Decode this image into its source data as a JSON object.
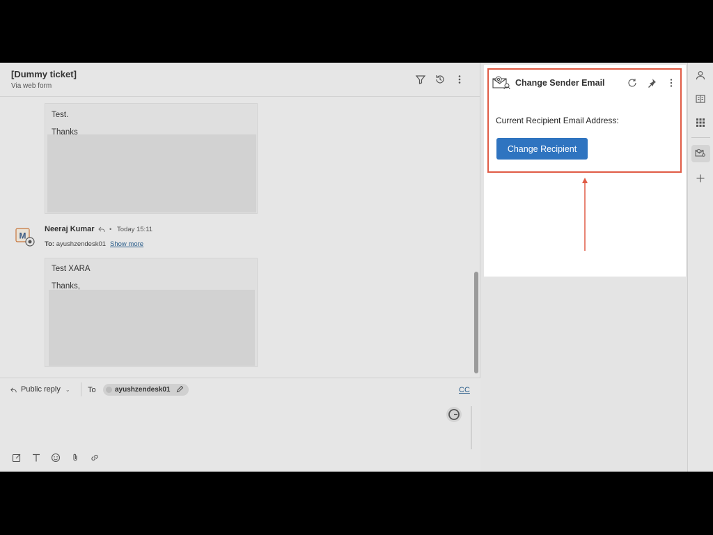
{
  "ticket": {
    "title": "[Dummy ticket]",
    "subtitle": "Via web form"
  },
  "messages": [
    {
      "lines": [
        "Test.",
        "Thanks"
      ]
    },
    {
      "author": "Neeraj Kumar",
      "time": "Today 15:11",
      "to_label": "To:",
      "to_value": "ayushzendesk01",
      "show_more": "Show more",
      "lines": [
        "Test XARA",
        "Thanks,"
      ]
    }
  ],
  "author_avatar_letter": "M",
  "composer": {
    "reply_type": "Public reply",
    "to_label": "To",
    "recipient": "ayushzendesk01",
    "cc": "CC"
  },
  "app": {
    "title": "Change Sender Email",
    "recipient_label": "Current Recipient Email Address:",
    "button_label": "Change Recipient"
  },
  "colors": {
    "accent_button": "#2f74c0",
    "highlight": "#e05b45"
  },
  "icons": {
    "header": [
      "filter-icon",
      "history-icon",
      "more-vertical-icon"
    ],
    "toolbar": [
      "compose-icon",
      "text-format-icon",
      "emoji-icon",
      "attachment-icon",
      "link-icon"
    ],
    "rail": [
      "user-icon",
      "knowledge-icon",
      "apps-grid-icon",
      "email-app-icon",
      "add-icon"
    ]
  }
}
